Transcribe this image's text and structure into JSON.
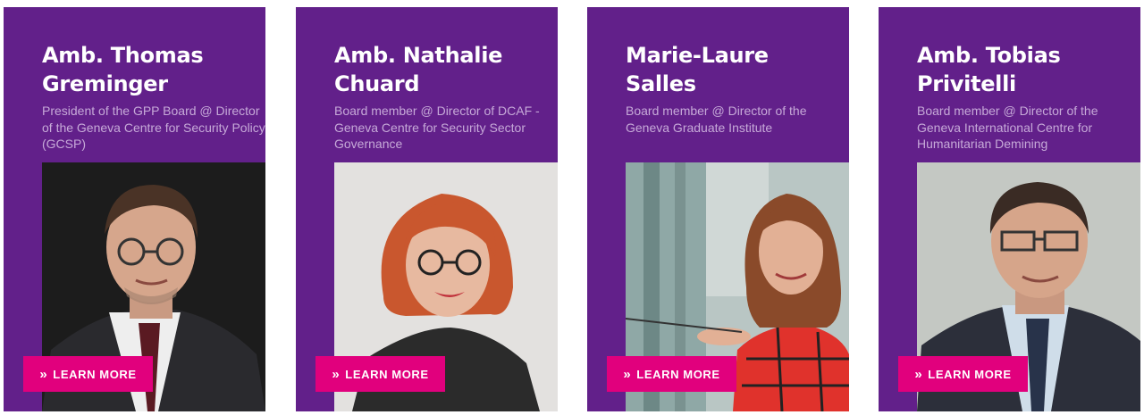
{
  "accent": "#e1007d",
  "card_color": "#62208a",
  "cards": [
    {
      "name": "Amb. Thomas Greminger",
      "role": "President of the GPP Board @ Director of the Geneva Centre for Security Policy (GCSP)",
      "button": "LEARN MORE",
      "icon": "double-chevron-right-icon"
    },
    {
      "name": "Amb. Nathalie Chuard",
      "role": "Board member @ Director of DCAF - Geneva Centre for Security Sector Governance",
      "button": "LEARN MORE",
      "icon": "double-chevron-right-icon"
    },
    {
      "name": "Marie-Laure Salles",
      "role": "Board member @ Director of the Geneva Graduate Institute",
      "button": "LEARN MORE",
      "icon": "double-chevron-right-icon"
    },
    {
      "name": "Amb. Tobias Privitelli",
      "role": "Board member @ Director of the Geneva International Centre for Humanitarian Demining",
      "button": "LEARN MORE",
      "icon": "double-chevron-right-icon"
    }
  ]
}
